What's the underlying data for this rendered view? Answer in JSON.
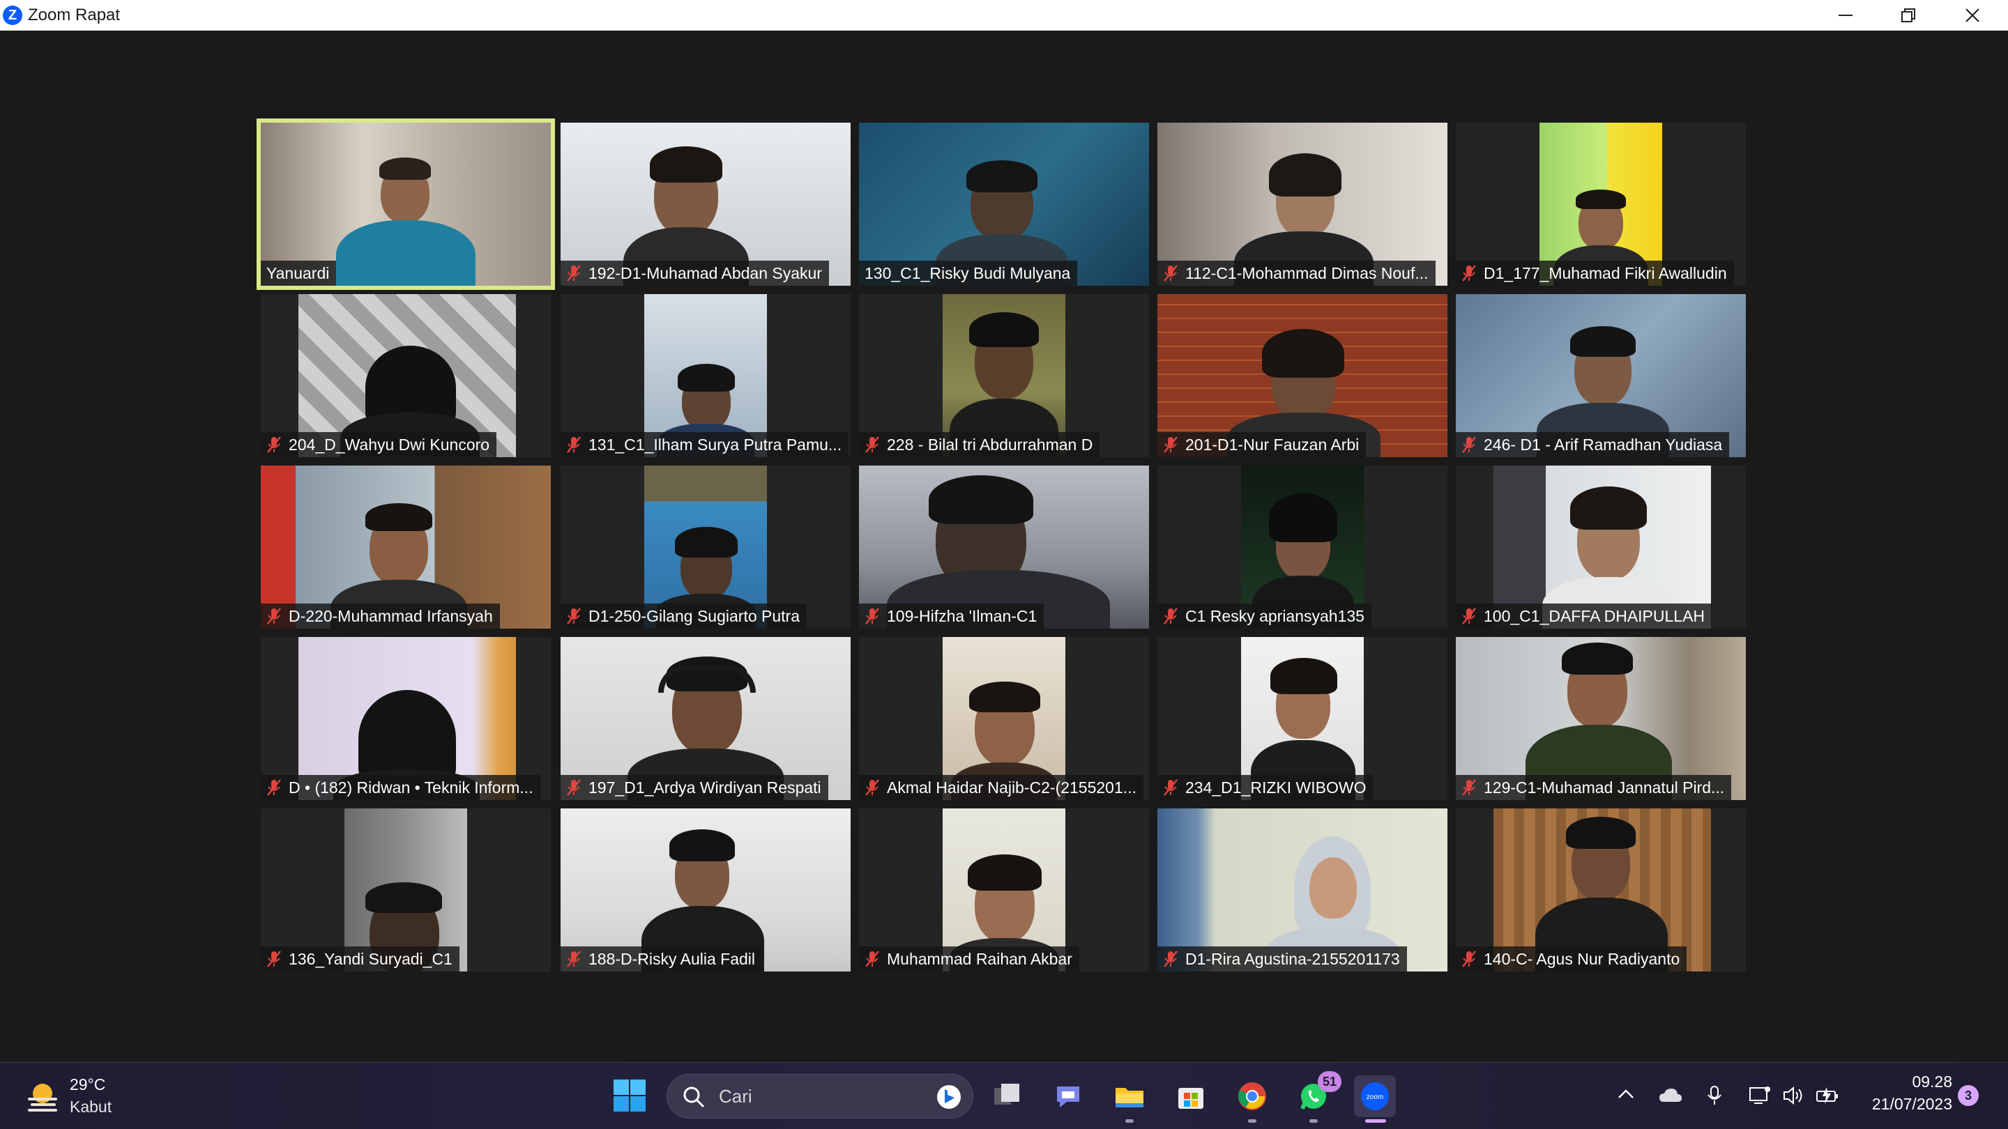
{
  "window": {
    "title": "Zoom Rapat",
    "logo_letter": "Z"
  },
  "participants": [
    {
      "name": "Yanuardi",
      "muted": false,
      "active_speaker": true
    },
    {
      "name": "192-D1-Muhamad Abdan Syakur",
      "muted": true
    },
    {
      "name": "130_C1_Risky Budi Mulyana",
      "muted": false
    },
    {
      "name": "112-C1-Mohammad Dimas Nouf...",
      "muted": true
    },
    {
      "name": "D1_177_Muhamad Fikri Awalludin",
      "muted": true
    },
    {
      "name": "204_D_Wahyu Dwi Kuncoro",
      "muted": true
    },
    {
      "name": "131_C1_Ilham Surya Putra Pamu...",
      "muted": true
    },
    {
      "name": "228 - Bilal tri Abdurrahman D",
      "muted": true
    },
    {
      "name": "201-D1-Nur Fauzan Arbi",
      "muted": true
    },
    {
      "name": "246- D1 - Arif Ramadhan Yudiasa",
      "muted": true
    },
    {
      "name": "D-220-Muhammad Irfansyah",
      "muted": true
    },
    {
      "name": "D1-250-Gilang Sugiarto Putra",
      "muted": true
    },
    {
      "name": "109-Hifzha 'Ilman-C1",
      "muted": true
    },
    {
      "name": "C1 Resky apriansyah135",
      "muted": true
    },
    {
      "name": "100_C1_DAFFA DHAIPULLAH",
      "muted": true
    },
    {
      "name": "D • (182) Ridwan • Teknik Inform...",
      "muted": true
    },
    {
      "name": "197_D1_Ardya Wirdiyan Respati",
      "muted": true
    },
    {
      "name": "Akmal Haidar Najib-C2-(2155201...",
      "muted": true
    },
    {
      "name": "234_D1_RIZKI WIBOWO",
      "muted": true
    },
    {
      "name": "129-C1-Muhamad Jannatul Pird...",
      "muted": true
    },
    {
      "name": "136_Yandi Suryadi_C1",
      "muted": true
    },
    {
      "name": "188-D-Risky Aulia Fadil",
      "muted": true
    },
    {
      "name": "Muhammad Raihan Akbar",
      "muted": true
    },
    {
      "name": "D1-Rira Agustina-2155201173",
      "muted": true
    },
    {
      "name": "140-C- Agus Nur Radiyanto",
      "muted": true
    }
  ],
  "taskbar": {
    "weather_temp": "29°C",
    "weather_desc": "Kabut",
    "search_placeholder": "Cari",
    "whatsapp_badge": "51",
    "clock_time": "09.28",
    "clock_date": "21/07/2023",
    "notification_count": "3"
  },
  "colors": {
    "active_speaker_border": "#dbe88a",
    "muted_icon": "#e0443e",
    "zoom_blue": "#0b5cff"
  }
}
